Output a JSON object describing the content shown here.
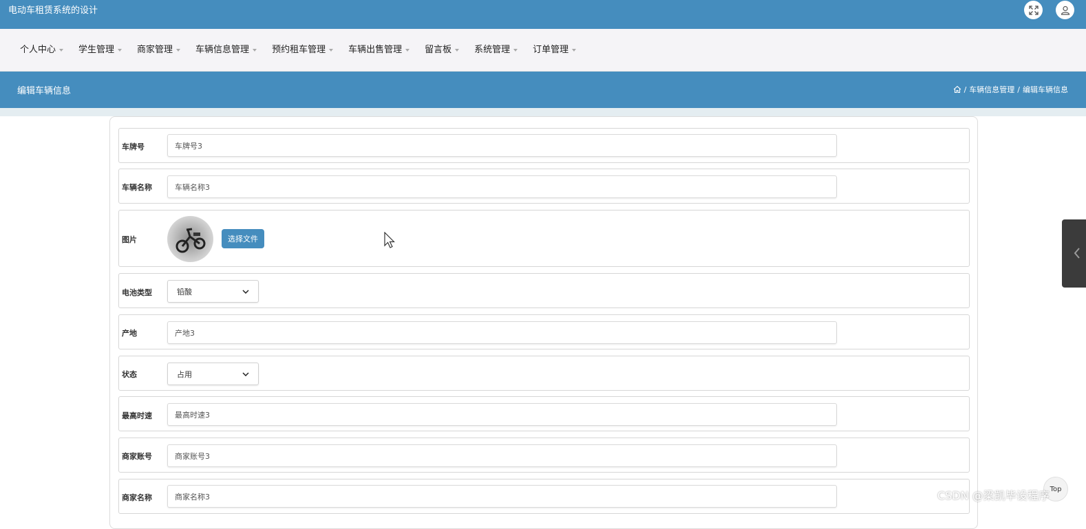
{
  "app": {
    "title": "电动车租赁系统的设计"
  },
  "header_icons": {
    "expand": "expand-icon",
    "user": "user-icon"
  },
  "nav": {
    "items": [
      {
        "label": "个人中心"
      },
      {
        "label": "学生管理"
      },
      {
        "label": "商家管理"
      },
      {
        "label": "车辆信息管理"
      },
      {
        "label": "预约租车管理"
      },
      {
        "label": "车辆出售管理"
      },
      {
        "label": "留言板"
      },
      {
        "label": "系统管理"
      },
      {
        "label": "订单管理"
      }
    ]
  },
  "banner": {
    "title": "编辑车辆信息",
    "breadcrumb": {
      "home_icon": "home-icon",
      "sep": "/",
      "section": "车辆信息管理",
      "current": "编辑车辆信息"
    }
  },
  "form": {
    "plate": {
      "label": "车牌号",
      "value": "车牌号3"
    },
    "name": {
      "label": "车辆名称",
      "value": "车辆名称3"
    },
    "image": {
      "label": "图片",
      "button": "选择文件"
    },
    "battery": {
      "label": "电池类型",
      "value": "铅酸"
    },
    "origin": {
      "label": "产地",
      "value": "产地3"
    },
    "status": {
      "label": "状态",
      "value": "占用"
    },
    "speed": {
      "label": "最高时速",
      "value": "最高时速3"
    },
    "merchant_account": {
      "label": "商家账号",
      "value": "商家账号3"
    },
    "merchant_name": {
      "label": "商家名称",
      "value": "商家名称3"
    }
  },
  "back_to_top": "Top",
  "watermark": "CSDN @梁凯毕设程序",
  "colors": {
    "primary": "#458dbe",
    "nav_bg": "#f5f4f7",
    "strip": "#e4edf1"
  }
}
